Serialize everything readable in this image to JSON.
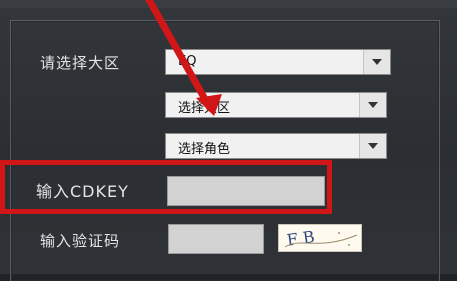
{
  "form": {
    "region_label": "请选择大区",
    "region_value": "EQ",
    "subregion_value": "选择大区",
    "role_value": "选择角色",
    "cdkey_label": "输入CDKEY",
    "cdkey_value": "",
    "captcha_label": "输入验证码",
    "captcha_value": "",
    "captcha_text": "F B"
  },
  "colors": {
    "annotation_red": "#d01616",
    "panel_bg": "#2b2e32"
  }
}
